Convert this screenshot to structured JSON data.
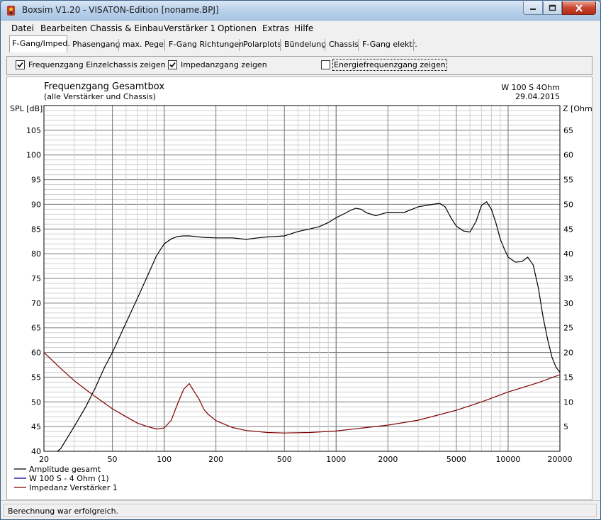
{
  "window": {
    "title": "Boxsim V1.20 - VISATON-Edition [noname.BPJ]",
    "title_color": "#1a1a1a"
  },
  "menu": [
    {
      "label": "Datei"
    },
    {
      "label": "Bearbeiten"
    },
    {
      "label": "Chassis & Einbau"
    },
    {
      "label": "Verstärker 1"
    },
    {
      "label": "Optionen"
    },
    {
      "label": "Extras"
    },
    {
      "label": "Hilfe"
    }
  ],
  "tabs": [
    {
      "label": "F-Gang/Imped.",
      "active": true
    },
    {
      "label": "Phasengang"
    },
    {
      "label": "max. Pegel"
    },
    {
      "label": "F-Gang Richtungen"
    },
    {
      "label": "Polarplots"
    },
    {
      "label": "Bündelung"
    },
    {
      "label": "Chassis"
    },
    {
      "label": "F-Gang elektr."
    }
  ],
  "options": {
    "single": {
      "label": "Frequenzgang Einzelchassis zeigen",
      "checked": true
    },
    "impedance": {
      "label": "Impedanzgang zeigen",
      "checked": true
    },
    "energy": {
      "label": "Energiefrequenzgang zeigen",
      "checked": false
    }
  },
  "chart_header": {
    "title": "Frequenzgang Gesamtbox",
    "subtitle": "(alle Verstärker und Chassis)",
    "speaker": "W 100 S 4Ohm",
    "date": "29.04.2015"
  },
  "status": {
    "text": "Berechnung war erfolgreich."
  },
  "chart_data": {
    "type": "line",
    "xlabel": "",
    "ylabel": "SPL [dB]",
    "y2label": "Z [Ohm]",
    "xscale": "log",
    "xlim": [
      20,
      20000
    ],
    "ylim": [
      40,
      110
    ],
    "y2lim": [
      0,
      70
    ],
    "xticks": [
      "20",
      "50",
      "100",
      "200",
      "500",
      "1000",
      "2000",
      "5000",
      "10000",
      "20000"
    ],
    "yticks": [
      "40",
      "45",
      "50",
      "55",
      "60",
      "65",
      "70",
      "75",
      "80",
      "85",
      "90",
      "95",
      "100",
      "105"
    ],
    "y2ticks": [
      "5",
      "10",
      "15",
      "20",
      "25",
      "30",
      "35",
      "40",
      "45",
      "50",
      "55",
      "60",
      "65"
    ],
    "grid": true,
    "legend_position": "bottom-left",
    "legend": [
      {
        "label": "Amplitude gesamt",
        "color": "#000000"
      },
      {
        "label": "W 100 S - 4 Ohm (1)",
        "color": "#00007f"
      },
      {
        "label": "Impedanz Verstärker 1",
        "color": "#7f0000"
      }
    ],
    "series": [
      {
        "name": "Amplitude gesamt",
        "color": "#000000",
        "axis": "left",
        "x": [
          20,
          25,
          30,
          35,
          40,
          45,
          50,
          60,
          70,
          80,
          90,
          100,
          110,
          120,
          130,
          140,
          150,
          170,
          200,
          250,
          300,
          350,
          400,
          500,
          600,
          700,
          800,
          900,
          1000,
          1100,
          1200,
          1300,
          1400,
          1500,
          1700,
          2000,
          2500,
          3000,
          3500,
          4000,
          4300,
          4700,
          5000,
          5500,
          6000,
          6500,
          7000,
          7500,
          8000,
          8500,
          9000,
          9500,
          10000,
          11000,
          12000,
          13000,
          14000,
          15000,
          16000,
          17000,
          18000,
          19000,
          20000
        ],
        "y": [
          38,
          40.5,
          45,
          49,
          53,
          57,
          60,
          66,
          71,
          75.5,
          79.5,
          82,
          83,
          83.5,
          83.6,
          83.6,
          83.5,
          83.3,
          83.2,
          83.2,
          82.9,
          83.2,
          83.4,
          83.6,
          84.5,
          85,
          85.5,
          86.3,
          87.3,
          88,
          88.7,
          89.2,
          89,
          88.3,
          87.7,
          88.4,
          88.4,
          89.5,
          89.9,
          90.2,
          89.5,
          87,
          85.6,
          84.6,
          84.4,
          86.5,
          89.8,
          90.5,
          89,
          86.2,
          83,
          81,
          79.3,
          78.3,
          78.4,
          79.3,
          77.7,
          73,
          67,
          62.5,
          59,
          57,
          56
        ]
      },
      {
        "name": "Impedanz Verstärker 1",
        "color": "#7f0000",
        "axis": "right",
        "x": [
          20,
          25,
          30,
          35,
          40,
          50,
          60,
          70,
          80,
          90,
          100,
          110,
          120,
          130,
          140,
          150,
          160,
          170,
          180,
          200,
          250,
          300,
          400,
          500,
          700,
          1000,
          1500,
          2000,
          3000,
          5000,
          7000,
          10000,
          15000,
          20000
        ],
        "y": [
          20,
          16.8,
          14.3,
          12.5,
          11,
          8.6,
          7,
          5.7,
          5,
          4.5,
          4.7,
          6.3,
          9.7,
          12.6,
          13.7,
          12,
          10.5,
          8.5,
          7.5,
          6.2,
          4.8,
          4.2,
          3.8,
          3.7,
          3.8,
          4.1,
          4.8,
          5.3,
          6.3,
          8.3,
          10,
          12,
          13.9,
          15.5
        ]
      }
    ]
  }
}
